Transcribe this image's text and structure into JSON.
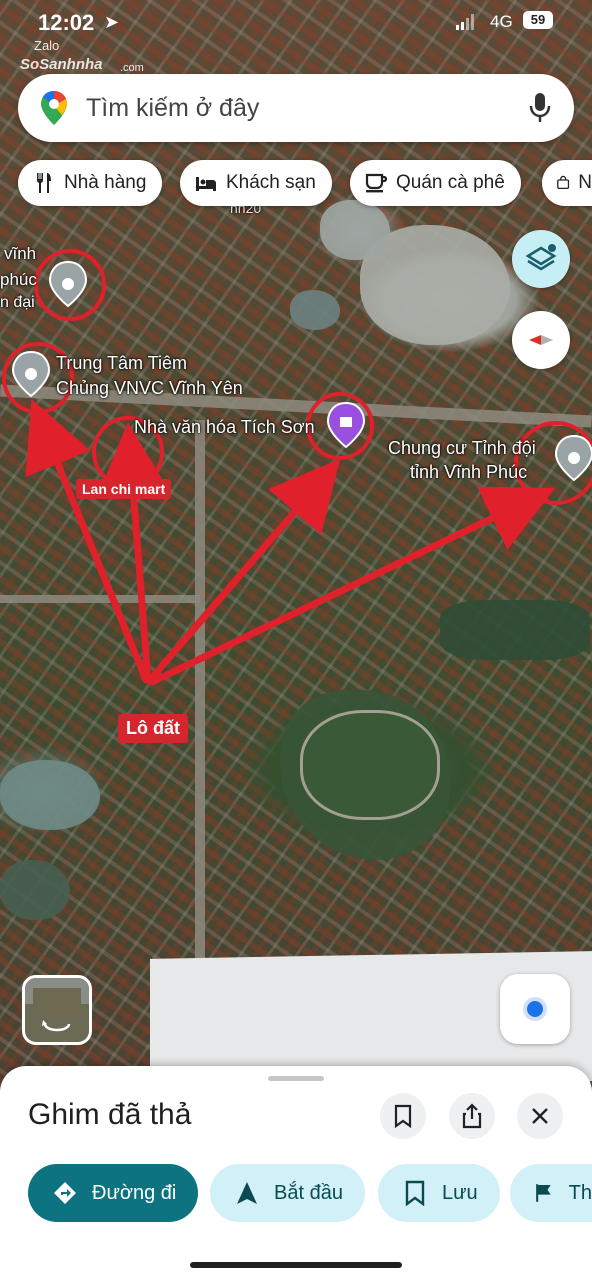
{
  "status_bar": {
    "time": "12:02",
    "network": "4G",
    "battery": "59",
    "watermark_app": "Zalo",
    "watermark_site": "SoSanhnha",
    "watermark_domain": ".com"
  },
  "search": {
    "placeholder": "Tìm kiếm ở đây"
  },
  "chips": [
    {
      "label": "Nhà hàng",
      "icon": "fork-knife-icon"
    },
    {
      "label": "Khách sạn",
      "icon": "bed-icon"
    },
    {
      "label": "Quán cà phê",
      "icon": "coffee-cup-icon"
    },
    {
      "label": "N",
      "icon": "shopping-bag-icon"
    }
  ],
  "map": {
    "labels": {
      "vinh_fragment": "vĩnh",
      "phuc_fragment": "phúc",
      "dai_fragment": "n đại",
      "vnvc_line1": "Trung Tâm Tiêm",
      "vnvc_line2": "Chủng VNVC Vĩnh Yên",
      "cultural_house": "Nhà văn hóa Tích Sơn",
      "apartment_line1": "Chung cư Tỉnh đội",
      "apartment_line2": "tỉnh Vĩnh Phúc",
      "partial_label": "nh20",
      "lan_chi_mart": "Lan chi mart",
      "lot": "Lô đất"
    },
    "colors": {
      "annotation_red": "#e0202a",
      "pin_gray": "#9aa3a6",
      "pin_purple": "#9b4fe0"
    }
  },
  "bottom_sheet": {
    "title": "Ghim đã thả",
    "actions": [
      {
        "label": "Đường đi",
        "icon": "directions-icon"
      },
      {
        "label": "Bắt đầu",
        "icon": "navigation-arrow-icon"
      },
      {
        "label": "Lưu",
        "icon": "bookmark-icon"
      },
      {
        "label": "Th",
        "icon": "flag-icon"
      }
    ]
  }
}
